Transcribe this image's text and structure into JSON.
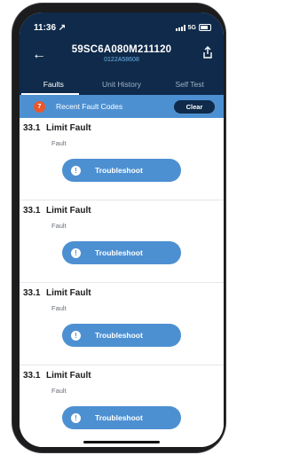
{
  "status": {
    "time": "11:36 ↗",
    "network": "5G"
  },
  "header": {
    "title": "59SC6A080M211120",
    "subtitle": "0122A58608"
  },
  "tabs": [
    {
      "label": "Faults",
      "active": true
    },
    {
      "label": "Unit History",
      "active": false
    },
    {
      "label": "Self Test",
      "active": false
    }
  ],
  "banner": {
    "count": "7",
    "label": "Recent Fault Codes",
    "clear_label": "Clear"
  },
  "faults": [
    {
      "code": "33.1",
      "name": "Limit Fault",
      "type": "Fault",
      "button": "Troubleshoot"
    },
    {
      "code": "33.1",
      "name": "Limit Fault",
      "type": "Fault",
      "button": "Troubleshoot"
    },
    {
      "code": "33.1",
      "name": "Limit Fault",
      "type": "Fault",
      "button": "Troubleshoot"
    },
    {
      "code": "33.1",
      "name": "Limit Fault",
      "type": "Fault",
      "button": "Troubleshoot"
    }
  ],
  "colors": {
    "header": "#0f2a4a",
    "accent": "#4d90d2",
    "badge": "#e8582c"
  },
  "icons": [
    "back-arrow-icon",
    "share-icon",
    "exclamation-icon",
    "signal-icon",
    "battery-icon"
  ]
}
